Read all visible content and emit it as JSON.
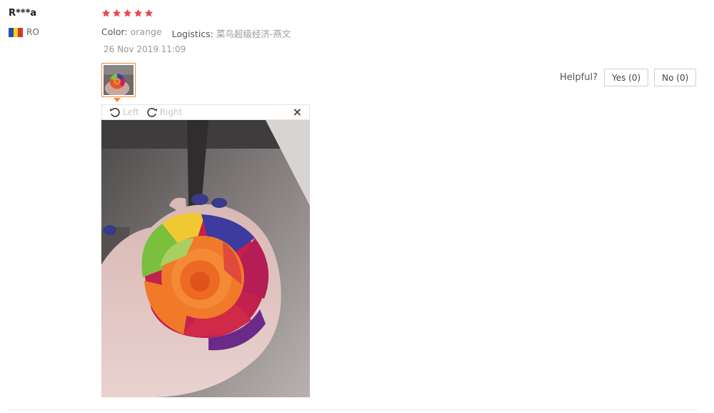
{
  "reviewer": {
    "name": "R***a",
    "country_code": "RO",
    "flag_colors": [
      "#2b4fa6",
      "#f2d21b",
      "#d1392b"
    ]
  },
  "rating": {
    "stars": 5,
    "max": 5,
    "color": "#e8484f"
  },
  "attributes": {
    "color_label": "Color:",
    "color_value": "orange",
    "logistics_label": "Logistics:",
    "logistics_value": "菜鸟超级经济-燕文"
  },
  "date": "26 Nov 2019 11:09",
  "photo_viewer": {
    "rotate_left_label": "Left",
    "rotate_right_label": "Right",
    "close_symbol": "×",
    "accent_color": "#f08c3a"
  },
  "helpful": {
    "label": "Helpful?",
    "yes_label": "Yes (0)",
    "no_label": "No (0)"
  }
}
